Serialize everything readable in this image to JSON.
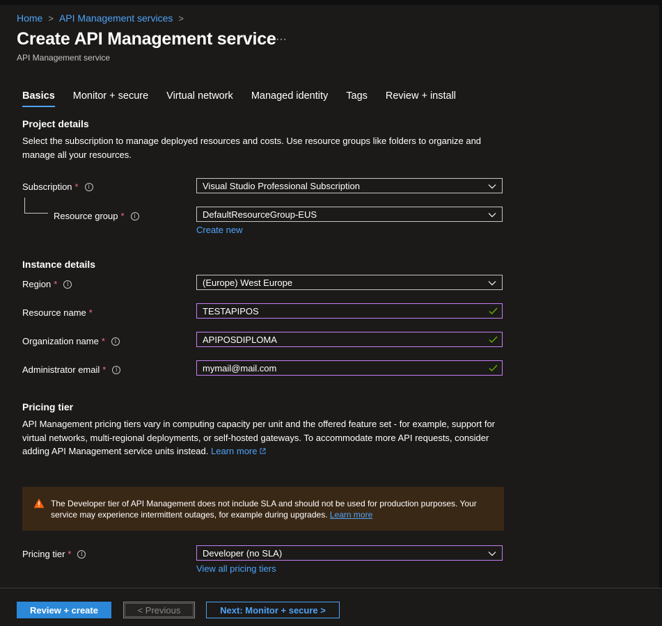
{
  "breadcrumb": {
    "home": "Home",
    "services": "API Management services",
    "separator": ">"
  },
  "header": {
    "title": "Create API Management service",
    "more": "···",
    "subtitle": "API Management service"
  },
  "tabs": [
    {
      "label": "Basics",
      "active": true
    },
    {
      "label": "Monitor + secure"
    },
    {
      "label": "Virtual network"
    },
    {
      "label": "Managed identity"
    },
    {
      "label": "Tags"
    },
    {
      "label": "Review + install"
    }
  ],
  "project": {
    "heading": "Project details",
    "description": "Select the subscription to manage deployed resources and costs. Use resource groups like folders to organize and manage all your resources.",
    "subscription": {
      "label": "Subscription",
      "value": "Visual Studio Professional Subscription"
    },
    "resource_group": {
      "label": "Resource group",
      "value": "DefaultResourceGroup-EUS",
      "create_new": "Create new"
    }
  },
  "instance": {
    "heading": "Instance details",
    "region": {
      "label": "Region",
      "value": "(Europe) West Europe"
    },
    "resource_name": {
      "label": "Resource name",
      "value": "TESTAPIPOS"
    },
    "organization_name": {
      "label": "Organization name",
      "value": "APIPOSDIPLOMA"
    },
    "admin_email": {
      "label": "Administrator email",
      "value": "mymail@mail.com"
    }
  },
  "pricing": {
    "heading": "Pricing tier",
    "description": "API Management pricing tiers vary in computing capacity per unit and the offered feature set - for example, support for virtual networks, multi-regional deployments, or self-hosted gateways. To accommodate more API requests, consider adding API Management service units instead.",
    "learn_more": "Learn more",
    "warning": "The Developer tier of API Management does not include SLA and should not be used for production purposes. Your service may experience intermittent outages, for example during upgrades.",
    "warning_link": "Learn more",
    "tier": {
      "label": "Pricing tier",
      "value": "Developer (no SLA)"
    },
    "view_all": "View all pricing tiers"
  },
  "footer": {
    "review_create": "Review + create",
    "previous": "< Previous",
    "next": "Next: Monitor + secure >"
  },
  "required_marker": "*",
  "info_glyph": "i",
  "colors": {
    "accent": "#4fa3f7",
    "primary_button": "#2b88d8",
    "required": "#f1707b",
    "valid_border": "#c77ff5",
    "check": "#6bb700",
    "warning_bg": "#3a2816",
    "warning_icon": "#f7630c"
  }
}
